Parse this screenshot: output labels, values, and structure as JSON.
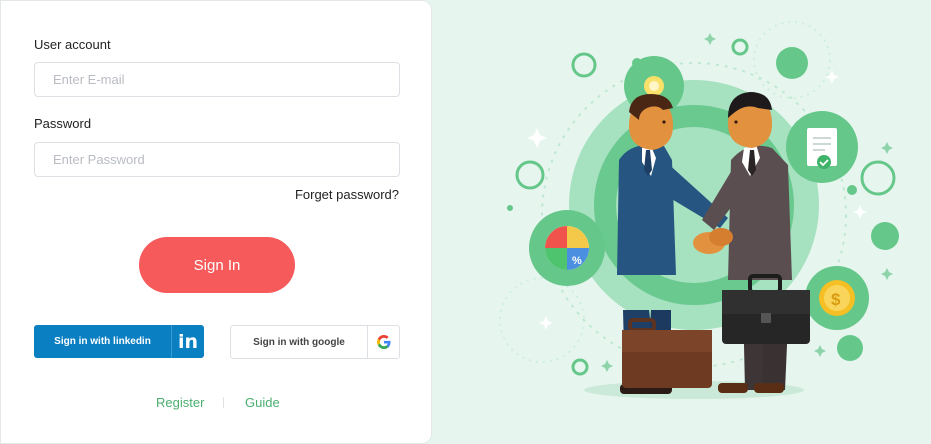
{
  "form": {
    "account_label": "User account",
    "email_placeholder": "Enter E-mail",
    "password_label": "Password",
    "password_placeholder": "Enter Password",
    "forgot_label": "Forget password?",
    "signin_label": "Sign In"
  },
  "social": {
    "linkedin_label": "Sign in with linkedin",
    "linkedin_icon": "linkedin-icon",
    "google_label": "Sign in with google",
    "google_icon": "google-icon"
  },
  "footer": {
    "register_label": "Register",
    "guide_label": "Guide"
  },
  "colors": {
    "accent_red": "#f65a5b",
    "linkedin_blue": "#0a7fc2",
    "link_green": "#4cae6f",
    "background_mint": "#e6f6ee"
  }
}
